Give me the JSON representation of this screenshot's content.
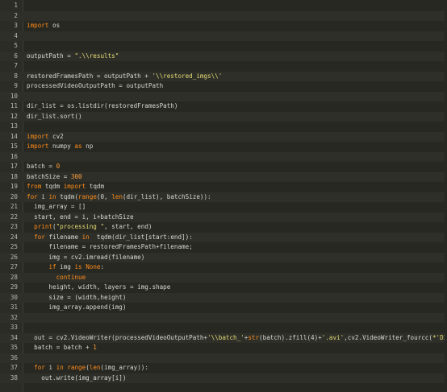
{
  "editor": {
    "lines": [
      {
        "n": "1",
        "segments": []
      },
      {
        "n": "2",
        "segments": []
      },
      {
        "n": "3",
        "segments": [
          {
            "t": "kw",
            "v": "import"
          },
          {
            "t": "plain",
            "v": " os"
          }
        ]
      },
      {
        "n": "4",
        "segments": []
      },
      {
        "n": "5",
        "segments": []
      },
      {
        "n": "6",
        "segments": [
          {
            "t": "plain",
            "v": "outputPath = "
          },
          {
            "t": "str",
            "v": "\".\\\\results\""
          }
        ]
      },
      {
        "n": "7",
        "segments": []
      },
      {
        "n": "8",
        "segments": [
          {
            "t": "plain",
            "v": "restoredFramesPath = outputPath + "
          },
          {
            "t": "str",
            "v": "'\\\\restored_imgs\\\\'"
          }
        ]
      },
      {
        "n": "9",
        "segments": [
          {
            "t": "plain",
            "v": "processedVideoOutputPath = outputPath"
          }
        ]
      },
      {
        "n": "10",
        "segments": []
      },
      {
        "n": "11",
        "segments": [
          {
            "t": "plain",
            "v": "dir_list = os.listdir(restoredFramesPath)"
          }
        ]
      },
      {
        "n": "12",
        "segments": [
          {
            "t": "plain",
            "v": "dir_list.sort()"
          }
        ]
      },
      {
        "n": "13",
        "segments": []
      },
      {
        "n": "14",
        "segments": [
          {
            "t": "kw",
            "v": "import"
          },
          {
            "t": "plain",
            "v": " cv2"
          }
        ]
      },
      {
        "n": "15",
        "segments": [
          {
            "t": "kw",
            "v": "import"
          },
          {
            "t": "plain",
            "v": " numpy "
          },
          {
            "t": "kw",
            "v": "as"
          },
          {
            "t": "plain",
            "v": " np"
          }
        ]
      },
      {
        "n": "16",
        "segments": []
      },
      {
        "n": "17",
        "segments": [
          {
            "t": "plain",
            "v": "batch = "
          },
          {
            "t": "num",
            "v": "0"
          }
        ]
      },
      {
        "n": "18",
        "segments": [
          {
            "t": "plain",
            "v": "batchSize = "
          },
          {
            "t": "num",
            "v": "300"
          }
        ]
      },
      {
        "n": "19",
        "segments": [
          {
            "t": "kw",
            "v": "from"
          },
          {
            "t": "plain",
            "v": " tqdm "
          },
          {
            "t": "kw",
            "v": "import"
          },
          {
            "t": "plain",
            "v": " tqdm"
          }
        ]
      },
      {
        "n": "20",
        "segments": [
          {
            "t": "kw",
            "v": "for"
          },
          {
            "t": "plain",
            "v": " i "
          },
          {
            "t": "kw",
            "v": "in"
          },
          {
            "t": "plain",
            "v": " tqdm("
          },
          {
            "t": "kw",
            "v": "range"
          },
          {
            "t": "plain",
            "v": "(0, "
          },
          {
            "t": "kw",
            "v": "len"
          },
          {
            "t": "plain",
            "v": "(dir_list), batchSize)):"
          }
        ]
      },
      {
        "n": "21",
        "segments": [
          {
            "t": "plain",
            "v": "  img_array = []"
          }
        ]
      },
      {
        "n": "22",
        "segments": [
          {
            "t": "plain",
            "v": "  start, end = i, i+batchSize"
          }
        ]
      },
      {
        "n": "23",
        "segments": [
          {
            "t": "plain",
            "v": "  "
          },
          {
            "t": "kw",
            "v": "print"
          },
          {
            "t": "plain",
            "v": "("
          },
          {
            "t": "str",
            "v": "\"processing \""
          },
          {
            "t": "plain",
            "v": ", start, end)"
          }
        ]
      },
      {
        "n": "24",
        "segments": [
          {
            "t": "plain",
            "v": "  "
          },
          {
            "t": "kw",
            "v": "for"
          },
          {
            "t": "plain",
            "v": " filename "
          },
          {
            "t": "kw",
            "v": "in"
          },
          {
            "t": "plain",
            "v": "  tqdm(dir_list[start:end]):"
          }
        ]
      },
      {
        "n": "25",
        "segments": [
          {
            "t": "plain",
            "v": "      filename = restoredFramesPath+filename;"
          }
        ]
      },
      {
        "n": "26",
        "segments": [
          {
            "t": "plain",
            "v": "      img = cv2.imread(filename)"
          }
        ]
      },
      {
        "n": "27",
        "segments": [
          {
            "t": "plain",
            "v": "      "
          },
          {
            "t": "kw",
            "v": "if"
          },
          {
            "t": "plain",
            "v": " img "
          },
          {
            "t": "kw",
            "v": "is"
          },
          {
            "t": "plain",
            "v": " "
          },
          {
            "t": "kw",
            "v": "None"
          },
          {
            "t": "plain",
            "v": ":"
          }
        ]
      },
      {
        "n": "28",
        "segments": [
          {
            "t": "plain",
            "v": "        "
          },
          {
            "t": "kw",
            "v": "continue"
          }
        ]
      },
      {
        "n": "29",
        "segments": [
          {
            "t": "plain",
            "v": "      height, width, layers = img.shape"
          }
        ]
      },
      {
        "n": "30",
        "segments": [
          {
            "t": "plain",
            "v": "      size = (width,height)"
          }
        ]
      },
      {
        "n": "31",
        "segments": [
          {
            "t": "plain",
            "v": "      img_array.append(img)"
          }
        ]
      },
      {
        "n": "32",
        "segments": []
      },
      {
        "n": "33",
        "segments": []
      },
      {
        "n": "34",
        "segments": [
          {
            "t": "plain",
            "v": "  out = cv2.VideoWriter(processedVideoOutputPath+"
          },
          {
            "t": "str",
            "v": "'\\\\batch_'"
          },
          {
            "t": "plain",
            "v": "+"
          },
          {
            "t": "kw",
            "v": "str"
          },
          {
            "t": "plain",
            "v": "(batch).zfill(4)+"
          },
          {
            "t": "str",
            "v": "'.avi'"
          },
          {
            "t": "plain",
            "v": ",cv2.VideoWriter_fourcc("
          },
          {
            "t": "str",
            "v": "*'DIVX'"
          }
        ]
      },
      {
        "n": "35",
        "segments": [
          {
            "t": "plain",
            "v": "  batch = batch + "
          },
          {
            "t": "num",
            "v": "1"
          }
        ]
      },
      {
        "n": "36",
        "segments": []
      },
      {
        "n": "37",
        "segments": [
          {
            "t": "plain",
            "v": "  "
          },
          {
            "t": "kw",
            "v": "for"
          },
          {
            "t": "plain",
            "v": " i "
          },
          {
            "t": "kw",
            "v": "in"
          },
          {
            "t": "plain",
            "v": " "
          },
          {
            "t": "kw",
            "v": "range"
          },
          {
            "t": "plain",
            "v": "("
          },
          {
            "t": "kw",
            "v": "len"
          },
          {
            "t": "plain",
            "v": "(img_array)):"
          }
        ]
      },
      {
        "n": "38",
        "segments": [
          {
            "t": "plain",
            "v": "    out.write(img_array[i])"
          }
        ]
      }
    ]
  },
  "colors": {
    "background": "#272822",
    "keyword": "#ff8c1a",
    "string": "#e6db74",
    "number": "#ff9d3a",
    "plain": "#d8d8d2",
    "line_number": "#b8b8b0"
  }
}
